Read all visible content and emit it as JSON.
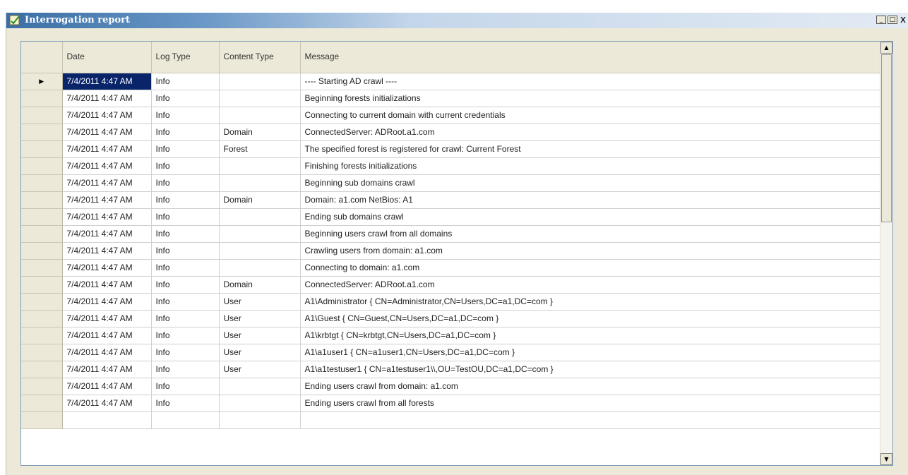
{
  "window": {
    "title": "Interrogation report",
    "icon": "report-icon",
    "controls": {
      "minimize": "_",
      "maximize": "□",
      "close": "x"
    }
  },
  "grid": {
    "columns": [
      {
        "key": "date",
        "label": "Date"
      },
      {
        "key": "log_type",
        "label": "Log Type"
      },
      {
        "key": "content_type",
        "label": "Content Type"
      },
      {
        "key": "message",
        "label": "Message"
      }
    ],
    "current_row_marker": "▶",
    "rows": [
      {
        "date": "7/4/2011 4:47 AM",
        "log_type": "Info",
        "content_type": "",
        "message": "---- Starting AD crawl ----"
      },
      {
        "date": "7/4/2011 4:47 AM",
        "log_type": "Info",
        "content_type": "",
        "message": "Beginning forests initializations"
      },
      {
        "date": "7/4/2011 4:47 AM",
        "log_type": "Info",
        "content_type": "",
        "message": "Connecting to current domain with current credentials"
      },
      {
        "date": "7/4/2011 4:47 AM",
        "log_type": "Info",
        "content_type": "Domain",
        "message": "ConnectedServer: ADRoot.a1.com"
      },
      {
        "date": "7/4/2011 4:47 AM",
        "log_type": "Info",
        "content_type": "Forest",
        "message": "The specified forest is registered for crawl: Current Forest"
      },
      {
        "date": "7/4/2011 4:47 AM",
        "log_type": "Info",
        "content_type": "",
        "message": "Finishing forests initializations"
      },
      {
        "date": "7/4/2011 4:47 AM",
        "log_type": "Info",
        "content_type": "",
        "message": "Beginning sub domains crawl"
      },
      {
        "date": "7/4/2011 4:47 AM",
        "log_type": "Info",
        "content_type": "Domain",
        "message": "Domain: a1.com NetBios: A1"
      },
      {
        "date": "7/4/2011 4:47 AM",
        "log_type": "Info",
        "content_type": "",
        "message": "Ending sub domains crawl"
      },
      {
        "date": "7/4/2011 4:47 AM",
        "log_type": "Info",
        "content_type": "",
        "message": "Beginning users crawl from all domains"
      },
      {
        "date": "7/4/2011 4:47 AM",
        "log_type": "Info",
        "content_type": "",
        "message": "Crawling users from domain: a1.com"
      },
      {
        "date": "7/4/2011 4:47 AM",
        "log_type": "Info",
        "content_type": "",
        "message": "Connecting to domain: a1.com"
      },
      {
        "date": "7/4/2011 4:47 AM",
        "log_type": "Info",
        "content_type": "Domain",
        "message": "ConnectedServer: ADRoot.a1.com"
      },
      {
        "date": "7/4/2011 4:47 AM",
        "log_type": "Info",
        "content_type": "User",
        "message": "A1\\Administrator { CN=Administrator,CN=Users,DC=a1,DC=com }"
      },
      {
        "date": "7/4/2011 4:47 AM",
        "log_type": "Info",
        "content_type": "User",
        "message": "A1\\Guest { CN=Guest,CN=Users,DC=a1,DC=com }"
      },
      {
        "date": "7/4/2011 4:47 AM",
        "log_type": "Info",
        "content_type": "User",
        "message": "A1\\krbtgt { CN=krbtgt,CN=Users,DC=a1,DC=com }"
      },
      {
        "date": "7/4/2011 4:47 AM",
        "log_type": "Info",
        "content_type": "User",
        "message": "A1\\a1user1 { CN=a1user1,CN=Users,DC=a1,DC=com }"
      },
      {
        "date": "7/4/2011 4:47 AM",
        "log_type": "Info",
        "content_type": "User",
        "message": "A1\\a1testuser1 { CN=a1testuser1\\\\,OU=TestOU,DC=a1,DC=com }"
      },
      {
        "date": "7/4/2011 4:47 AM",
        "log_type": "Info",
        "content_type": "",
        "message": "Ending users crawl from domain: a1.com"
      },
      {
        "date": "7/4/2011 4:47 AM",
        "log_type": "Info",
        "content_type": "",
        "message": "Ending users crawl from all forests"
      },
      {
        "date": "",
        "log_type": "",
        "content_type": "",
        "message": ""
      }
    ]
  },
  "scrollbar": {
    "up_arrow": "▲",
    "down_arrow": "▼"
  }
}
